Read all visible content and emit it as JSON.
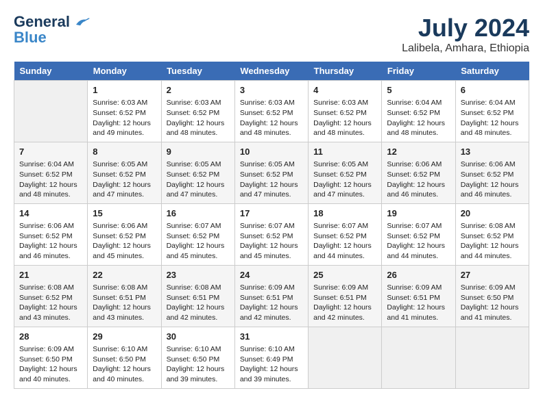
{
  "header": {
    "logo_line1": "General",
    "logo_line2": "Blue",
    "month_year": "July 2024",
    "location": "Lalibela, Amhara, Ethiopia"
  },
  "days_of_week": [
    "Sunday",
    "Monday",
    "Tuesday",
    "Wednesday",
    "Thursday",
    "Friday",
    "Saturday"
  ],
  "weeks": [
    [
      {
        "day": "",
        "sunrise": "",
        "sunset": "",
        "daylight": ""
      },
      {
        "day": "1",
        "sunrise": "Sunrise: 6:03 AM",
        "sunset": "Sunset: 6:52 PM",
        "daylight": "Daylight: 12 hours and 49 minutes."
      },
      {
        "day": "2",
        "sunrise": "Sunrise: 6:03 AM",
        "sunset": "Sunset: 6:52 PM",
        "daylight": "Daylight: 12 hours and 48 minutes."
      },
      {
        "day": "3",
        "sunrise": "Sunrise: 6:03 AM",
        "sunset": "Sunset: 6:52 PM",
        "daylight": "Daylight: 12 hours and 48 minutes."
      },
      {
        "day": "4",
        "sunrise": "Sunrise: 6:03 AM",
        "sunset": "Sunset: 6:52 PM",
        "daylight": "Daylight: 12 hours and 48 minutes."
      },
      {
        "day": "5",
        "sunrise": "Sunrise: 6:04 AM",
        "sunset": "Sunset: 6:52 PM",
        "daylight": "Daylight: 12 hours and 48 minutes."
      },
      {
        "day": "6",
        "sunrise": "Sunrise: 6:04 AM",
        "sunset": "Sunset: 6:52 PM",
        "daylight": "Daylight: 12 hours and 48 minutes."
      }
    ],
    [
      {
        "day": "7",
        "sunrise": "Sunrise: 6:04 AM",
        "sunset": "Sunset: 6:52 PM",
        "daylight": "Daylight: 12 hours and 48 minutes."
      },
      {
        "day": "8",
        "sunrise": "Sunrise: 6:05 AM",
        "sunset": "Sunset: 6:52 PM",
        "daylight": "Daylight: 12 hours and 47 minutes."
      },
      {
        "day": "9",
        "sunrise": "Sunrise: 6:05 AM",
        "sunset": "Sunset: 6:52 PM",
        "daylight": "Daylight: 12 hours and 47 minutes."
      },
      {
        "day": "10",
        "sunrise": "Sunrise: 6:05 AM",
        "sunset": "Sunset: 6:52 PM",
        "daylight": "Daylight: 12 hours and 47 minutes."
      },
      {
        "day": "11",
        "sunrise": "Sunrise: 6:05 AM",
        "sunset": "Sunset: 6:52 PM",
        "daylight": "Daylight: 12 hours and 47 minutes."
      },
      {
        "day": "12",
        "sunrise": "Sunrise: 6:06 AM",
        "sunset": "Sunset: 6:52 PM",
        "daylight": "Daylight: 12 hours and 46 minutes."
      },
      {
        "day": "13",
        "sunrise": "Sunrise: 6:06 AM",
        "sunset": "Sunset: 6:52 PM",
        "daylight": "Daylight: 12 hours and 46 minutes."
      }
    ],
    [
      {
        "day": "14",
        "sunrise": "Sunrise: 6:06 AM",
        "sunset": "Sunset: 6:52 PM",
        "daylight": "Daylight: 12 hours and 46 minutes."
      },
      {
        "day": "15",
        "sunrise": "Sunrise: 6:06 AM",
        "sunset": "Sunset: 6:52 PM",
        "daylight": "Daylight: 12 hours and 45 minutes."
      },
      {
        "day": "16",
        "sunrise": "Sunrise: 6:07 AM",
        "sunset": "Sunset: 6:52 PM",
        "daylight": "Daylight: 12 hours and 45 minutes."
      },
      {
        "day": "17",
        "sunrise": "Sunrise: 6:07 AM",
        "sunset": "Sunset: 6:52 PM",
        "daylight": "Daylight: 12 hours and 45 minutes."
      },
      {
        "day": "18",
        "sunrise": "Sunrise: 6:07 AM",
        "sunset": "Sunset: 6:52 PM",
        "daylight": "Daylight: 12 hours and 44 minutes."
      },
      {
        "day": "19",
        "sunrise": "Sunrise: 6:07 AM",
        "sunset": "Sunset: 6:52 PM",
        "daylight": "Daylight: 12 hours and 44 minutes."
      },
      {
        "day": "20",
        "sunrise": "Sunrise: 6:08 AM",
        "sunset": "Sunset: 6:52 PM",
        "daylight": "Daylight: 12 hours and 44 minutes."
      }
    ],
    [
      {
        "day": "21",
        "sunrise": "Sunrise: 6:08 AM",
        "sunset": "Sunset: 6:52 PM",
        "daylight": "Daylight: 12 hours and 43 minutes."
      },
      {
        "day": "22",
        "sunrise": "Sunrise: 6:08 AM",
        "sunset": "Sunset: 6:51 PM",
        "daylight": "Daylight: 12 hours and 43 minutes."
      },
      {
        "day": "23",
        "sunrise": "Sunrise: 6:08 AM",
        "sunset": "Sunset: 6:51 PM",
        "daylight": "Daylight: 12 hours and 42 minutes."
      },
      {
        "day": "24",
        "sunrise": "Sunrise: 6:09 AM",
        "sunset": "Sunset: 6:51 PM",
        "daylight": "Daylight: 12 hours and 42 minutes."
      },
      {
        "day": "25",
        "sunrise": "Sunrise: 6:09 AM",
        "sunset": "Sunset: 6:51 PM",
        "daylight": "Daylight: 12 hours and 42 minutes."
      },
      {
        "day": "26",
        "sunrise": "Sunrise: 6:09 AM",
        "sunset": "Sunset: 6:51 PM",
        "daylight": "Daylight: 12 hours and 41 minutes."
      },
      {
        "day": "27",
        "sunrise": "Sunrise: 6:09 AM",
        "sunset": "Sunset: 6:50 PM",
        "daylight": "Daylight: 12 hours and 41 minutes."
      }
    ],
    [
      {
        "day": "28",
        "sunrise": "Sunrise: 6:09 AM",
        "sunset": "Sunset: 6:50 PM",
        "daylight": "Daylight: 12 hours and 40 minutes."
      },
      {
        "day": "29",
        "sunrise": "Sunrise: 6:10 AM",
        "sunset": "Sunset: 6:50 PM",
        "daylight": "Daylight: 12 hours and 40 minutes."
      },
      {
        "day": "30",
        "sunrise": "Sunrise: 6:10 AM",
        "sunset": "Sunset: 6:50 PM",
        "daylight": "Daylight: 12 hours and 39 minutes."
      },
      {
        "day": "31",
        "sunrise": "Sunrise: 6:10 AM",
        "sunset": "Sunset: 6:49 PM",
        "daylight": "Daylight: 12 hours and 39 minutes."
      },
      {
        "day": "",
        "sunrise": "",
        "sunset": "",
        "daylight": ""
      },
      {
        "day": "",
        "sunrise": "",
        "sunset": "",
        "daylight": ""
      },
      {
        "day": "",
        "sunrise": "",
        "sunset": "",
        "daylight": ""
      }
    ]
  ]
}
